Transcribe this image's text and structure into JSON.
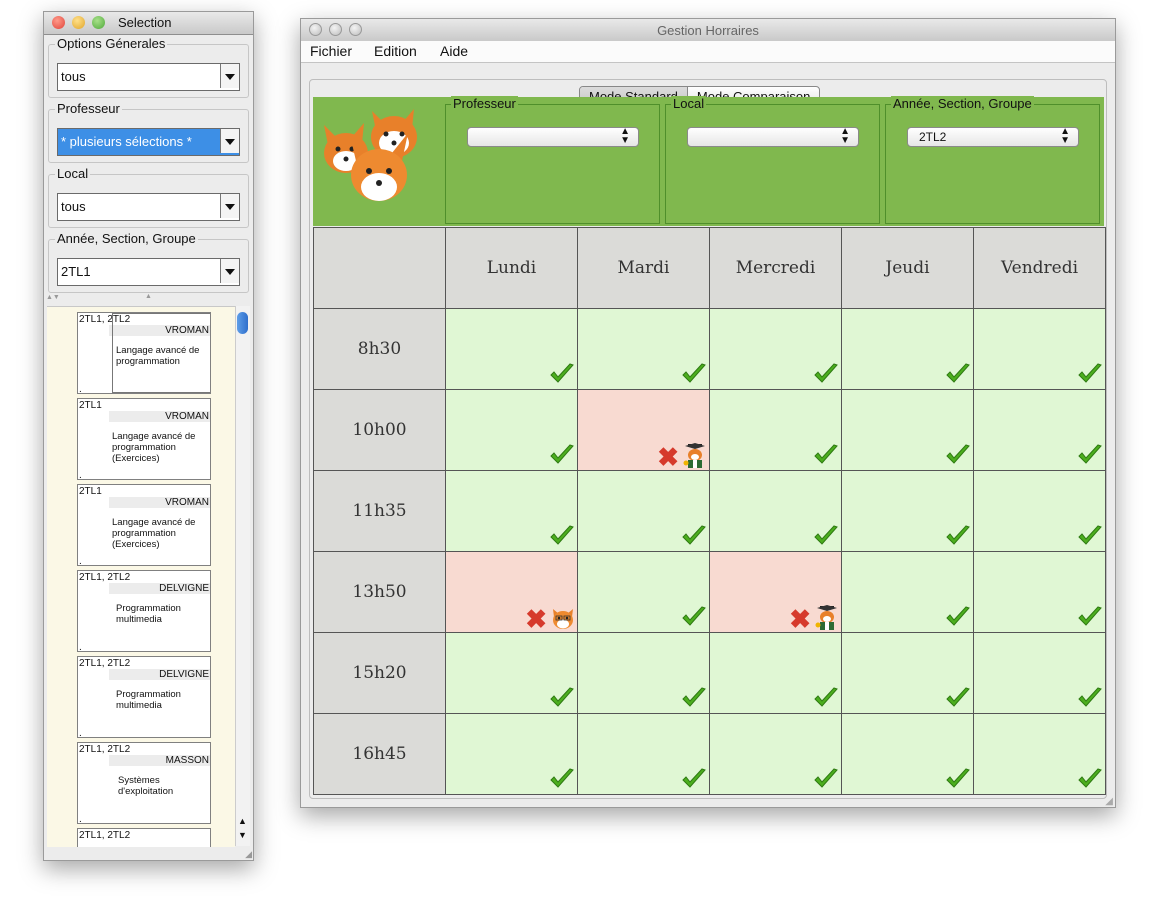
{
  "selection_window": {
    "title": "Selection",
    "groups": [
      {
        "legend": "Options Génerales",
        "value": "tous"
      },
      {
        "legend": "Professeur",
        "value": "* plusieurs sélections *"
      },
      {
        "legend": "Local",
        "value": "tous"
      },
      {
        "legend": "Année, Section, Groupe",
        "value": "2TL1"
      }
    ],
    "cards": [
      {
        "group": "2TL1, 2TL2",
        "prof": "VROMAN",
        "course": "Langage avancé de programmation"
      },
      {
        "group": "2TL1",
        "prof": "VROMAN",
        "course": "Langage avancé de programmation (Exercices)"
      },
      {
        "group": "2TL1",
        "prof": "VROMAN",
        "course": "Langage avancé de programmation (Exercices)"
      },
      {
        "group": "2TL1, 2TL2",
        "prof": "DELVIGNE",
        "course": "Programmation multimedia"
      },
      {
        "group": "2TL1, 2TL2",
        "prof": "DELVIGNE",
        "course": "Programmation multimedia"
      },
      {
        "group": "2TL1, 2TL2",
        "prof": "MASSON",
        "course": "Systèmes d'exploitation"
      },
      {
        "group": "2TL1, 2TL2",
        "prof": "",
        "course": ""
      }
    ],
    "card_dot": "."
  },
  "main_window": {
    "title": "Gestion Horraires",
    "menu": [
      "Fichier",
      "Edition",
      "Aide"
    ],
    "modes": [
      "Mode Standard",
      "Mode Comparaison"
    ],
    "filters": [
      {
        "legend": "Professeur",
        "value": ""
      },
      {
        "legend": "Local",
        "value": ""
      },
      {
        "legend": "Année, Section, Groupe",
        "value": "2TL2"
      }
    ],
    "days": [
      "Lundi",
      "Mardi",
      "Mercredi",
      "Jeudi",
      "Vendredi"
    ],
    "times": [
      "8h30",
      "10h00",
      "11h35",
      "13h50",
      "15h20",
      "16h45"
    ],
    "schedule": [
      [
        "ok",
        "ok",
        "ok",
        "ok",
        "ok"
      ],
      [
        "ok",
        "conflict-teacher",
        "ok",
        "ok",
        "ok"
      ],
      [
        "ok",
        "ok",
        "ok",
        "ok",
        "ok"
      ],
      [
        "conflict-fox",
        "ok",
        "conflict-teacher",
        "ok",
        "ok"
      ],
      [
        "ok",
        "ok",
        "ok",
        "ok",
        "ok"
      ],
      [
        "ok",
        "ok",
        "ok",
        "ok",
        "ok"
      ]
    ],
    "icons": {
      "ok": "checkmark-icon",
      "conflict": "red-x-icon",
      "logo": "fox-logo-icon"
    },
    "colors": {
      "header_green": "#80b84e",
      "ok_cell": "#e0f7d4",
      "conflict_cell": "#f8dad1",
      "check": "#4cae1e",
      "cross": "#d63a2c"
    }
  }
}
